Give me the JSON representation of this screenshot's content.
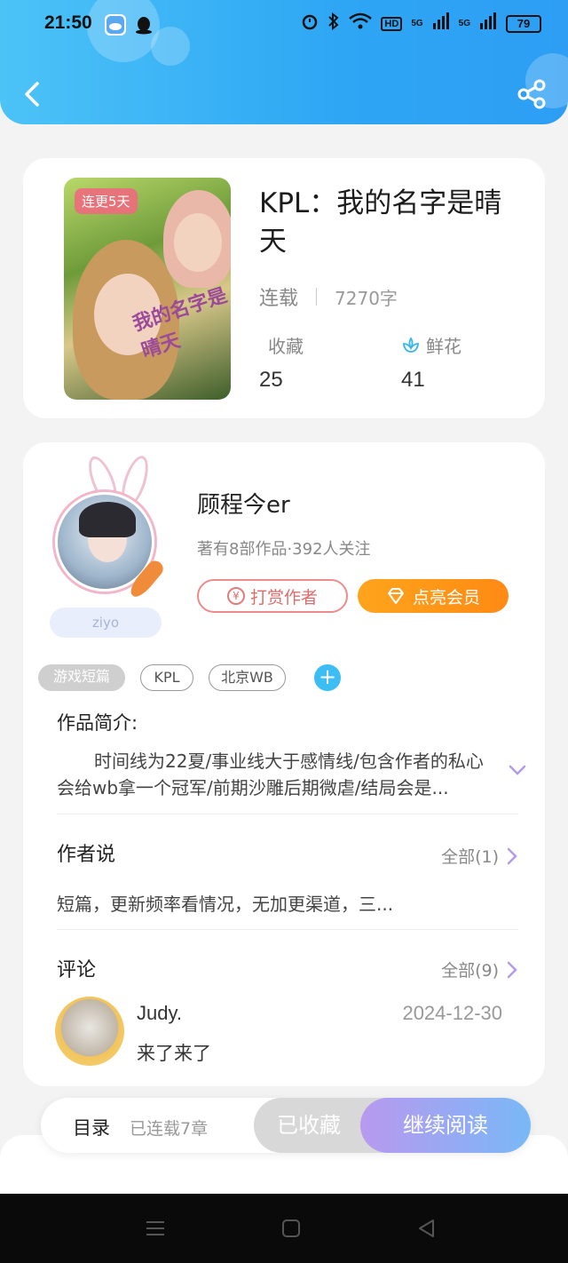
{
  "status_bar": {
    "time": "21:50",
    "battery": "79",
    "network": "5G"
  },
  "book": {
    "badge": "连更5天",
    "title": "KPL：我的名字是晴天",
    "status": "连载",
    "word_count": "7270字",
    "favorites_label": "收藏",
    "favorites_value": "25",
    "flowers_label": "鲜花",
    "flowers_value": "41",
    "cover_art_text": "我的名字是晴天"
  },
  "author": {
    "name": "顾程今er",
    "info": "著有8部作品·392人关注",
    "tip_button": "打赏作者",
    "tip_icon": "¥",
    "vip_button": "点亮会员",
    "name_tag": "ziyo"
  },
  "tags": [
    "游戏短篇",
    "KPL",
    "北京WB"
  ],
  "tag_add": "+",
  "intro": {
    "title": "作品简介:",
    "text": "时间线为22夏/事业线大于感情线/包含作者的私心会给wb拿一个冠军/前期沙雕后期微虐/结局会是..."
  },
  "author_say": {
    "title": "作者说",
    "more": "全部(1)",
    "text": "短篇，更新频率看情况，无加更渠道，三..."
  },
  "comments": {
    "title": "评论",
    "more": "全部(9)",
    "items": [
      {
        "user": "Judy.",
        "date": "2024-12-30",
        "text": "来了来了"
      }
    ]
  },
  "bottom_bar": {
    "toc": "目录",
    "chapters": "已连载7章",
    "favorited": "已收藏",
    "continue": "继续阅读"
  },
  "colors": {
    "header": "#2ea6f4",
    "accent_orange": "#ff8a14",
    "read_gradient_start": "#b999ef",
    "read_gradient_end": "#79b8f7"
  }
}
